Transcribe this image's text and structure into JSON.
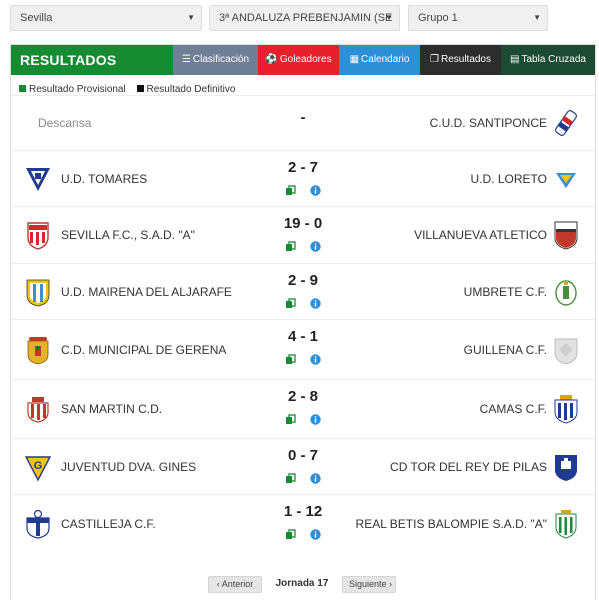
{
  "filters": {
    "province": "Sevilla",
    "competition": "3ª ANDALUZA PREBENJAMIN (SE",
    "group": "Grupo 1"
  },
  "tabs": {
    "title": "RESULTADOS",
    "clasificacion": "Clasificación",
    "goleadores": "Goleadores",
    "calendario": "Calendario",
    "resultados": "Resultados",
    "cruzada": "Tabla Cruzada"
  },
  "legend": {
    "provisional": "Resultado Provisional",
    "definitivo": "Resultado Definitivo",
    "provisional_color": "#168c32",
    "definitivo_color": "#111111"
  },
  "matches": [
    {
      "home": "Descansa",
      "score": "-",
      "away": "C.U.D. SANTIPONCE"
    },
    {
      "home": "U.D. TOMARES",
      "score": "2 - 7",
      "away": "U.D. LORETO"
    },
    {
      "home": "SEVILLA F.C., S.A.D. \"A\"",
      "score": "19 - 0",
      "away": "VILLANUEVA ATLETICO"
    },
    {
      "home": "U.D. MAIRENA DEL ALJARAFE",
      "score": "2 - 9",
      "away": "UMBRETE C.F."
    },
    {
      "home": "C.D. MUNICIPAL DE GERENA",
      "score": "4 - 1",
      "away": "GUILLENA C.F."
    },
    {
      "home": "SAN MARTIN C.D.",
      "score": "2 - 8",
      "away": "CAMAS C.F."
    },
    {
      "home": "JUVENTUD DVA. GINES",
      "score": "0 - 7",
      "away": "CD TOR DEL REY DE PILAS"
    },
    {
      "home": "CASTILLEJA C.F.",
      "score": "1 - 12",
      "away": "REAL BETIS BALOMPIE S.A.D. \"A\""
    }
  ],
  "pager": {
    "prev": "Anterior",
    "label": "Jornada 17",
    "next": "Siguiente"
  },
  "colors": {
    "green": "#168c32",
    "red": "#e8202b",
    "blue": "#2d8fd6",
    "dark": "#2d2d2d",
    "darkgreen": "#1d4a32",
    "slate": "#6f7f95"
  }
}
